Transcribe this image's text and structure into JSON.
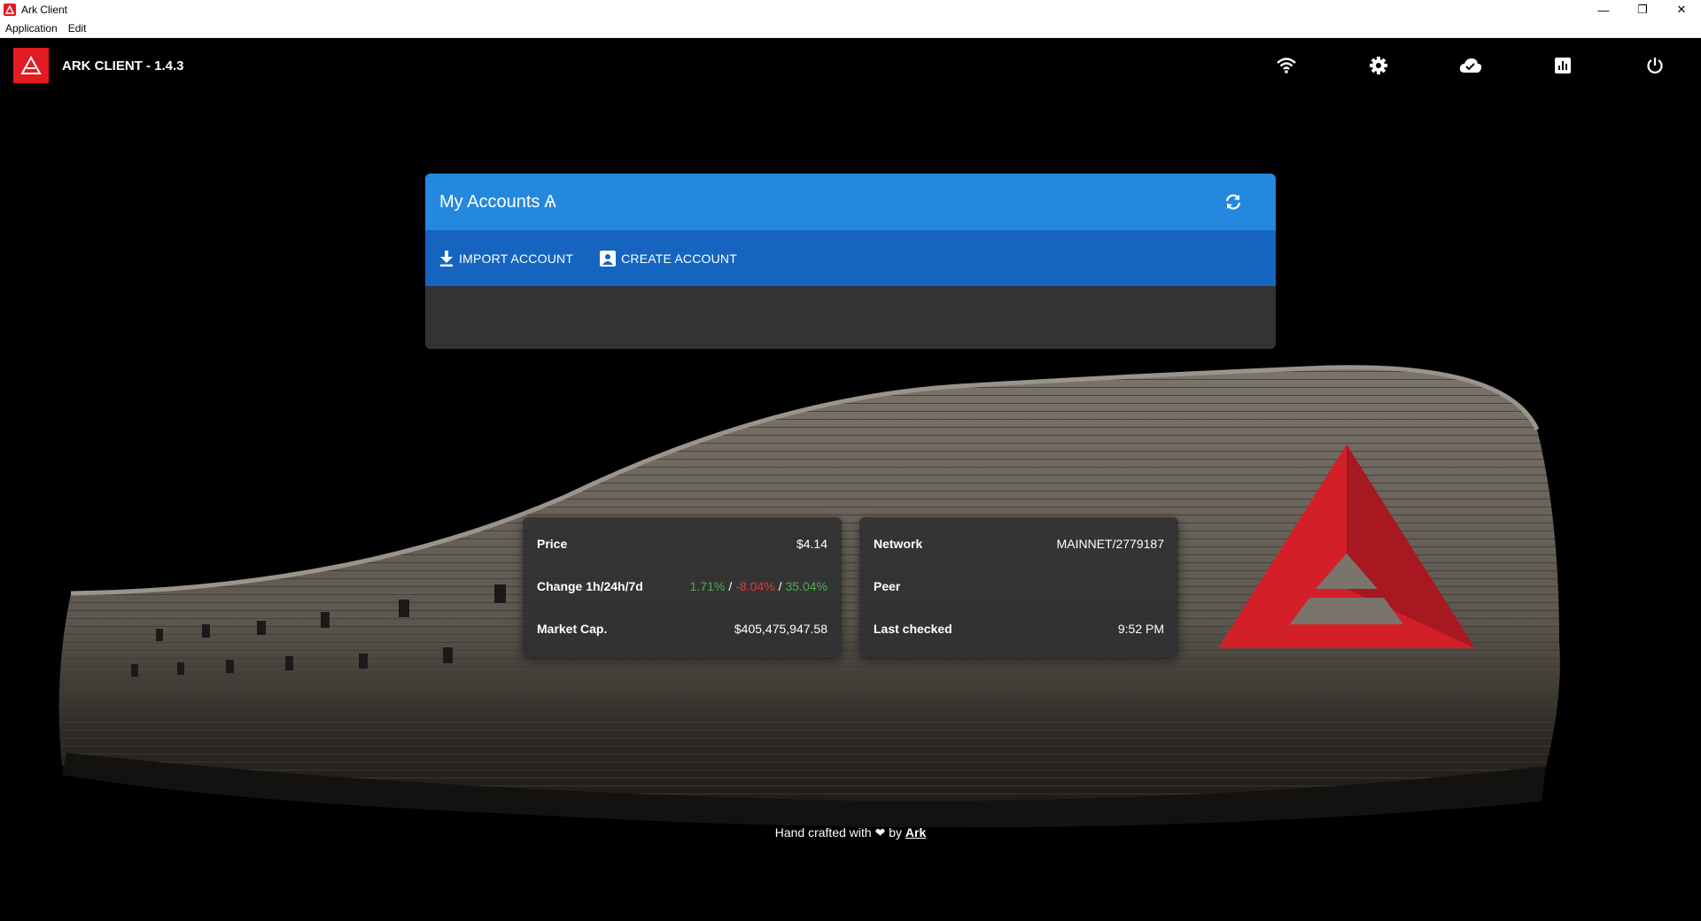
{
  "window": {
    "title": "Ark Client",
    "menu": [
      "Application",
      "Edit"
    ],
    "controls": [
      "minimize-icon",
      "restore-icon",
      "close-icon"
    ]
  },
  "header": {
    "title": "ARK CLIENT - 1.4.3",
    "icons": [
      "wifi-icon",
      "gear-icon",
      "cloud-done-icon",
      "chart-icon",
      "power-icon"
    ]
  },
  "accounts": {
    "title": "My Accounts",
    "symbol": "Ѧ",
    "import_label": "IMPORT ACCOUNT",
    "create_label": "CREATE ACCOUNT"
  },
  "market": {
    "price_label": "Price",
    "price_value": "$4.14",
    "change_label": "Change 1h/24h/7d",
    "change_1h": "1.71%",
    "change_24h": "-8.04%",
    "change_7d": "35.04%",
    "separator": "/",
    "marketcap_label": "Market Cap.",
    "marketcap_value": "$405,475,947.58"
  },
  "network": {
    "network_label": "Network",
    "network_value": "MAINNET/2779187",
    "peer_label": "Peer",
    "peer_value": "",
    "checked_label": "Last checked",
    "checked_value": "9:52 PM"
  },
  "footer": {
    "text_before": "Hand crafted with",
    "text_by": "by",
    "link": "Ark"
  },
  "colors": {
    "brand_red": "#e31b23",
    "card_blue": "#2488df",
    "toolbar_blue": "#1565c0",
    "positive": "#4caf50",
    "negative": "#e53935"
  }
}
